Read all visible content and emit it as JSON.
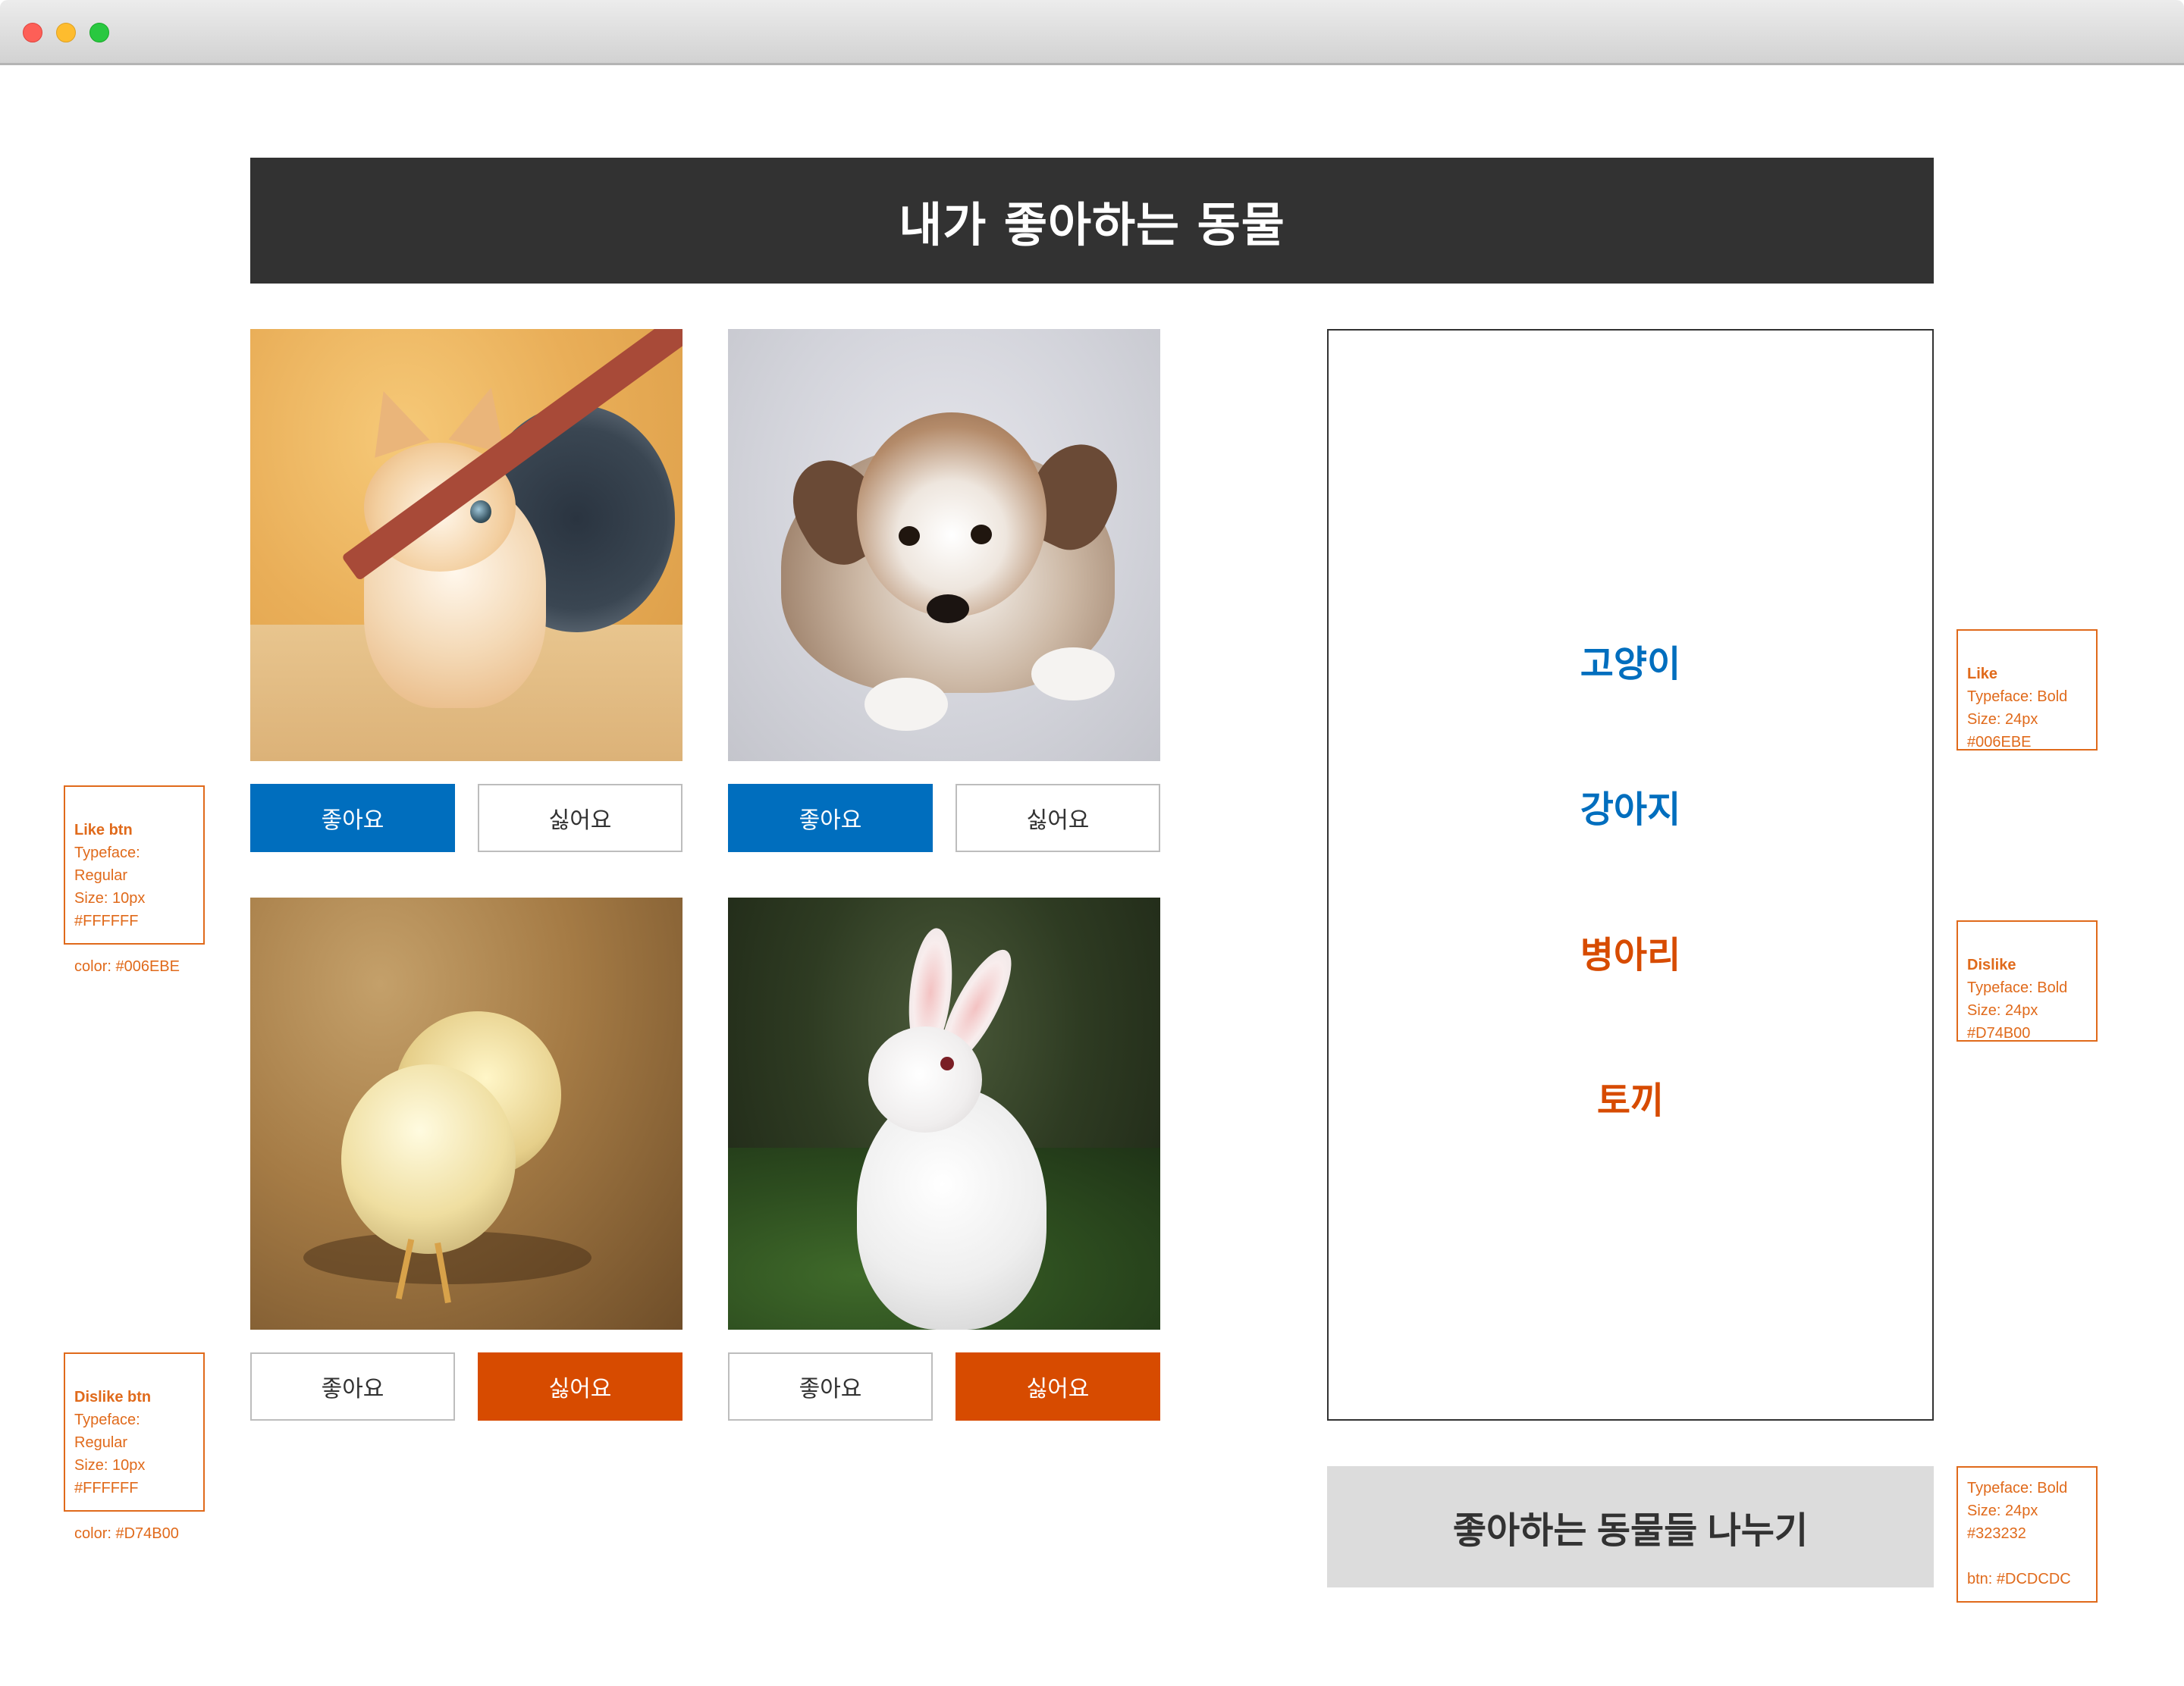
{
  "window": {
    "controls": [
      "close",
      "minimize",
      "maximize"
    ]
  },
  "header": {
    "title": "내가 좋아하는 동물"
  },
  "cards": [
    {
      "animal": "cat",
      "like_label": "좋아요",
      "dislike_label": "싫어요",
      "state": "like"
    },
    {
      "animal": "dog",
      "like_label": "좋아요",
      "dislike_label": "싫어요",
      "state": "like"
    },
    {
      "animal": "chick",
      "like_label": "좋아요",
      "dislike_label": "싫어요",
      "state": "dislike"
    },
    {
      "animal": "rabbit",
      "like_label": "좋아요",
      "dislike_label": "싫어요",
      "state": "dislike"
    }
  ],
  "results": [
    {
      "label": "고양이",
      "state": "like"
    },
    {
      "label": "강아지",
      "state": "like"
    },
    {
      "label": "병아리",
      "state": "dislike"
    },
    {
      "label": "토끼",
      "state": "dislike"
    }
  ],
  "share": {
    "label": "좋아하는 동물들 나누기"
  },
  "colors": {
    "like": "#006EBE",
    "dislike": "#D74B00",
    "title_bg": "#323232",
    "share_bg": "#DCDCDC",
    "annotation": "#E06A1B"
  },
  "annotations": {
    "like_btn": {
      "title": "Like btn",
      "lines": [
        "Typeface: Regular",
        "Size: 10px",
        "#FFFFFF",
        "",
        "color: #006EBE"
      ]
    },
    "dislike_btn": {
      "title": "Dislike btn",
      "lines": [
        "Typeface: Regular",
        "Size: 10px",
        "#FFFFFF",
        "",
        "color: #D74B00"
      ]
    },
    "like": {
      "title": "Like",
      "lines": [
        "Typeface: Bold",
        "Size: 24px",
        "#006EBE"
      ]
    },
    "dislike": {
      "title": "Dislike",
      "lines": [
        "Typeface: Bold",
        "Size: 24px",
        "#D74B00"
      ]
    },
    "share": {
      "title": "",
      "lines": [
        "Typeface: Bold",
        "Size: 24px",
        "#323232",
        "",
        "btn: #DCDCDC"
      ]
    }
  }
}
